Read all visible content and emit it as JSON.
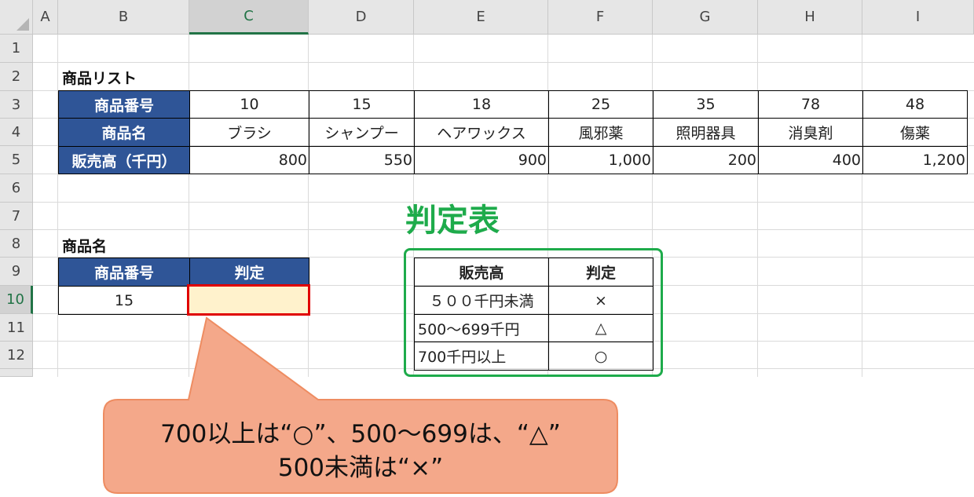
{
  "columns": [
    "A",
    "B",
    "C",
    "D",
    "E",
    "F",
    "G",
    "H",
    "I"
  ],
  "rows": [
    "1",
    "2",
    "3",
    "4",
    "5",
    "6",
    "7",
    "8",
    "9",
    "10",
    "11",
    "12"
  ],
  "selected_cell": "C10",
  "product_list": {
    "title": "商品リスト",
    "row_labels": [
      "商品番号",
      "商品名",
      "販売高（千円）"
    ],
    "numbers": [
      "10",
      "15",
      "18",
      "25",
      "35",
      "78",
      "48"
    ],
    "names": [
      "ブラシ",
      "シャンプー",
      "ヘアワックス",
      "風邪薬",
      "照明器具",
      "消臭剤",
      "傷薬"
    ],
    "sales": [
      "800",
      "550",
      "900",
      "1,000",
      "200",
      "400",
      "1,200"
    ]
  },
  "lookup": {
    "title": "商品名",
    "headers": [
      "商品番号",
      "判定"
    ],
    "value": "15",
    "result": ""
  },
  "judge_table": {
    "title": "判定表",
    "headers": [
      "販売高",
      "判定"
    ],
    "rows": [
      {
        "range": "５００千円未満",
        "mark": "×"
      },
      {
        "range": "500～699千円",
        "mark": "△"
      },
      {
        "range": "700千円以上",
        "mark": "○"
      }
    ]
  },
  "callout": {
    "line1": "700以上は“○”、500～699は、“△”",
    "line2": "500未満は“×”"
  },
  "colors": {
    "header_blue": "#2f5597",
    "accent_green": "#1eab4b",
    "selection_red": "#e00000",
    "callout_fill": "#f4a88a",
    "result_fill": "#fff2cc"
  }
}
